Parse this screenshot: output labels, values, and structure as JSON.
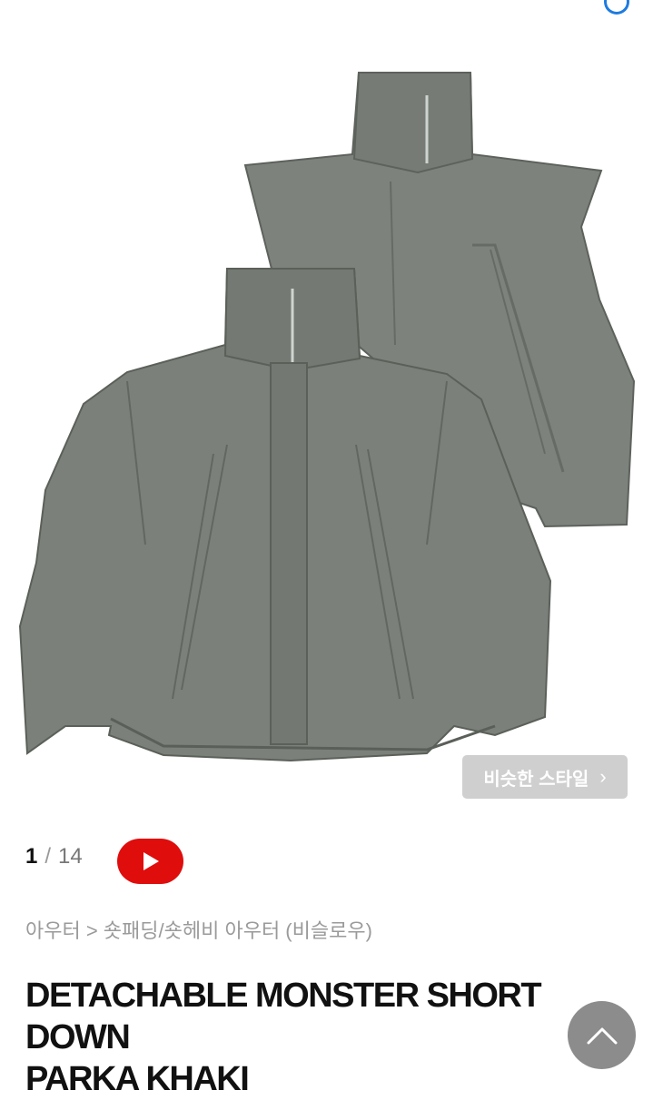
{
  "gallery": {
    "current": "1",
    "separator": "/",
    "total": "14",
    "similar_style_label": "비슷한 스타일",
    "chevron": "›"
  },
  "product": {
    "category_path": "아우터 > 숏패딩/숏헤비 아우터 (비슬로우)",
    "title_line1": "DETACHABLE MONSTER SHORT DOWN",
    "title_line2": "PARKA KHAKI",
    "jacket_color": "#7b817a"
  },
  "icons": {
    "video": "youtube-play-icon",
    "scroll_top": "chevron-up-icon"
  },
  "colors": {
    "youtube_red": "#e00d0d",
    "similar_button_bg": "#cfcfcf",
    "accent_blue": "#1e7be0"
  }
}
